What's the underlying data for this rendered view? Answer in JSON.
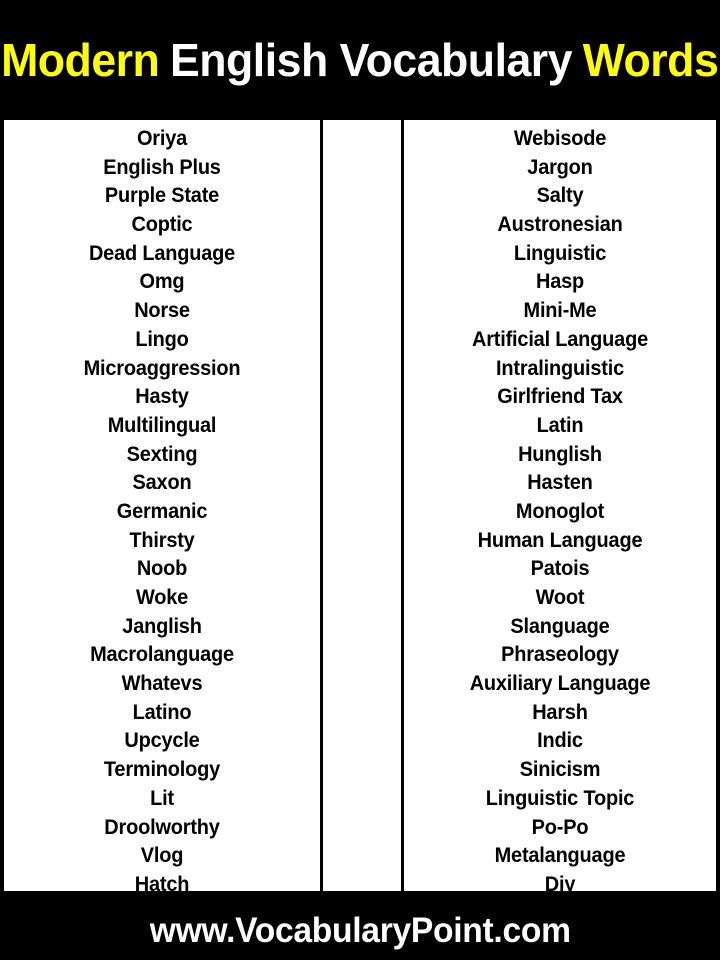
{
  "header": {
    "title_parts": [
      {
        "text": "Modern",
        "style": "accent"
      },
      {
        "text": "English Vocabulary",
        "style": "plain"
      },
      {
        "text": "Words",
        "style": "accent"
      }
    ],
    "title_full": "Modern English Vocabulary Words",
    "background_color": "#000000",
    "accent_color": "#FFFF00",
    "plain_color": "#FFFFFF"
  },
  "content": {
    "background_color": "#FFFFFF",
    "text_color": "#000000",
    "rule_color": "#000000",
    "columns": [
      {
        "name": "left-column",
        "words": [
          "Oriya",
          "English Plus",
          "Purple State",
          "Coptic",
          "Dead Language",
          "Omg",
          "Norse",
          "Lingo",
          "Microaggression",
          "Hasty",
          "Multilingual",
          "Sexting",
          "Saxon",
          "Germanic",
          "Thirsty",
          "Noob",
          "Woke",
          "Janglish",
          "Macrolanguage",
          "Whatevs",
          "Latino",
          "Upcycle",
          "Terminology",
          "Lit",
          "Droolworthy",
          "Vlog",
          "Hatch"
        ]
      },
      {
        "name": "middle-column",
        "words": []
      },
      {
        "name": "right-column",
        "words": [
          "Webisode",
          "Jargon",
          "Salty",
          "Austronesian",
          "Linguistic",
          "Hasp",
          "Mini-Me",
          "Artificial Language",
          "Intralinguistic",
          "Girlfriend Tax",
          "Latin",
          "Hunglish",
          "Hasten",
          "Monoglot",
          "Human Language",
          "Patois",
          "Woot",
          "Slanguage",
          "Phraseology",
          "Auxiliary Language",
          "Harsh",
          "Indic",
          "Sinicism",
          "Linguistic Topic",
          "Po-Po",
          "Metalanguage",
          "Diy"
        ]
      }
    ]
  },
  "footer": {
    "url": "www.VocabularyPoint.com",
    "background_color": "#000000",
    "text_color": "#FFFFFF"
  }
}
